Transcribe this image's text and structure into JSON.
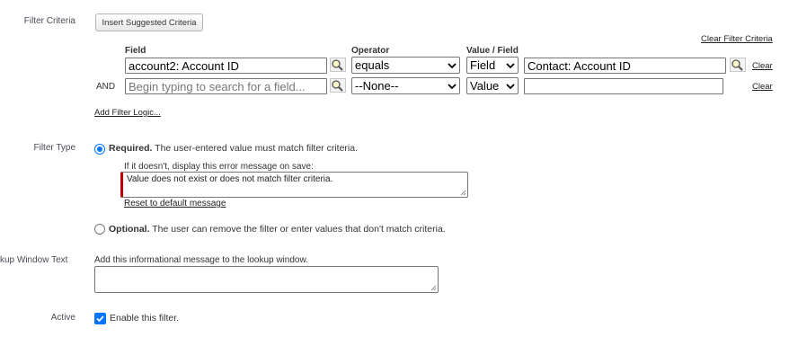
{
  "filter_criteria": {
    "label": "Filter Criteria",
    "insert_button": "Insert Suggested Criteria",
    "clear_all_link": "Clear Filter Criteria",
    "headers": {
      "field": "Field",
      "operator": "Operator",
      "value_field": "Value / Field"
    },
    "rows": [
      {
        "prefix": "",
        "field_value": "account2: Account ID",
        "field_placeholder": "",
        "operator": "equals",
        "type": "Field",
        "value": "Contact: Account ID",
        "show_value_lookup": true,
        "clear_label": "Clear"
      },
      {
        "prefix": "AND",
        "field_value": "",
        "field_placeholder": "Begin typing to search for a field...",
        "operator": "--None--",
        "type": "Value",
        "value": "",
        "show_value_lookup": false,
        "clear_label": "Clear"
      }
    ],
    "add_logic_link": "Add Filter Logic..."
  },
  "filter_type": {
    "label": "Filter Type",
    "required": {
      "title": "Required.",
      "desc": "The user-entered value must match filter criteria.",
      "checked": true
    },
    "error_prompt": "If it doesn't, display this error message on save:",
    "error_message": "Value does not exist or does not match filter criteria.",
    "reset_link": "Reset to default message",
    "optional": {
      "title": "Optional.",
      "desc": "The user can remove the filter or enter values that don't match criteria.",
      "checked": false
    }
  },
  "lookup_window": {
    "label": "kup Window Text",
    "prompt": "Add this informational message to the lookup window.",
    "value": ""
  },
  "active": {
    "label": "Active",
    "checkbox_label": "Enable this filter.",
    "checked": true
  },
  "colors": {
    "accent": "#0075ff",
    "error_bar": "#c00000"
  },
  "icons": {
    "lookup": "magnifier-lookup-icon",
    "dropdown": "chevron-down-icon",
    "checkmark": "checkmark-icon"
  }
}
